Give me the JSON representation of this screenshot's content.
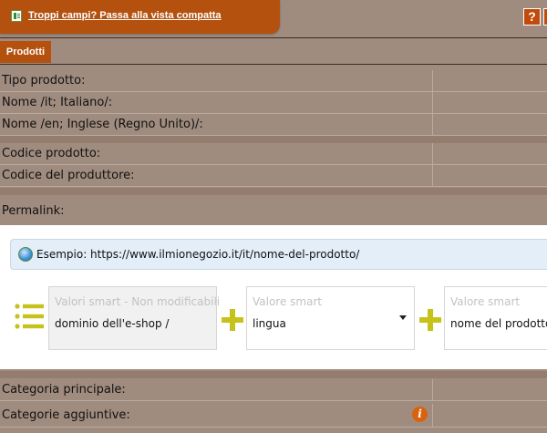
{
  "notice": {
    "link_text": "Troppi campi? Passa alla vista compatta"
  },
  "toolbar": {
    "help_label": "?"
  },
  "tabs": [
    {
      "label": "Prodotti"
    }
  ],
  "fields_group1": [
    {
      "label": "Tipo prodotto:"
    },
    {
      "label": "Nome /it; Italiano/:"
    },
    {
      "label": "Nome /en; Inglese (Regno Unito)/:"
    }
  ],
  "fields_group2": [
    {
      "label": "Codice prodotto:"
    },
    {
      "label": "Codice del produttore:"
    }
  ],
  "permalink": {
    "label": "Permalink:",
    "example": "Esempio: https://www.ilmionegozio.it/it/nome-del-prodotto/",
    "boxes": [
      {
        "title": "Valori smart - Non modificabili",
        "value": "dominio dell'e-shop /"
      },
      {
        "title": "Valore smart",
        "value": "lingua"
      },
      {
        "title": "Valore smart",
        "value": "nome del prodotto"
      }
    ]
  },
  "fields_group3": [
    {
      "label": "Categoria principale:"
    },
    {
      "label": "Categorie aggiuntive:"
    }
  ],
  "colors": {
    "accent": "#b4510e",
    "background": "#a08c7f",
    "plus": "#c6c21a"
  }
}
